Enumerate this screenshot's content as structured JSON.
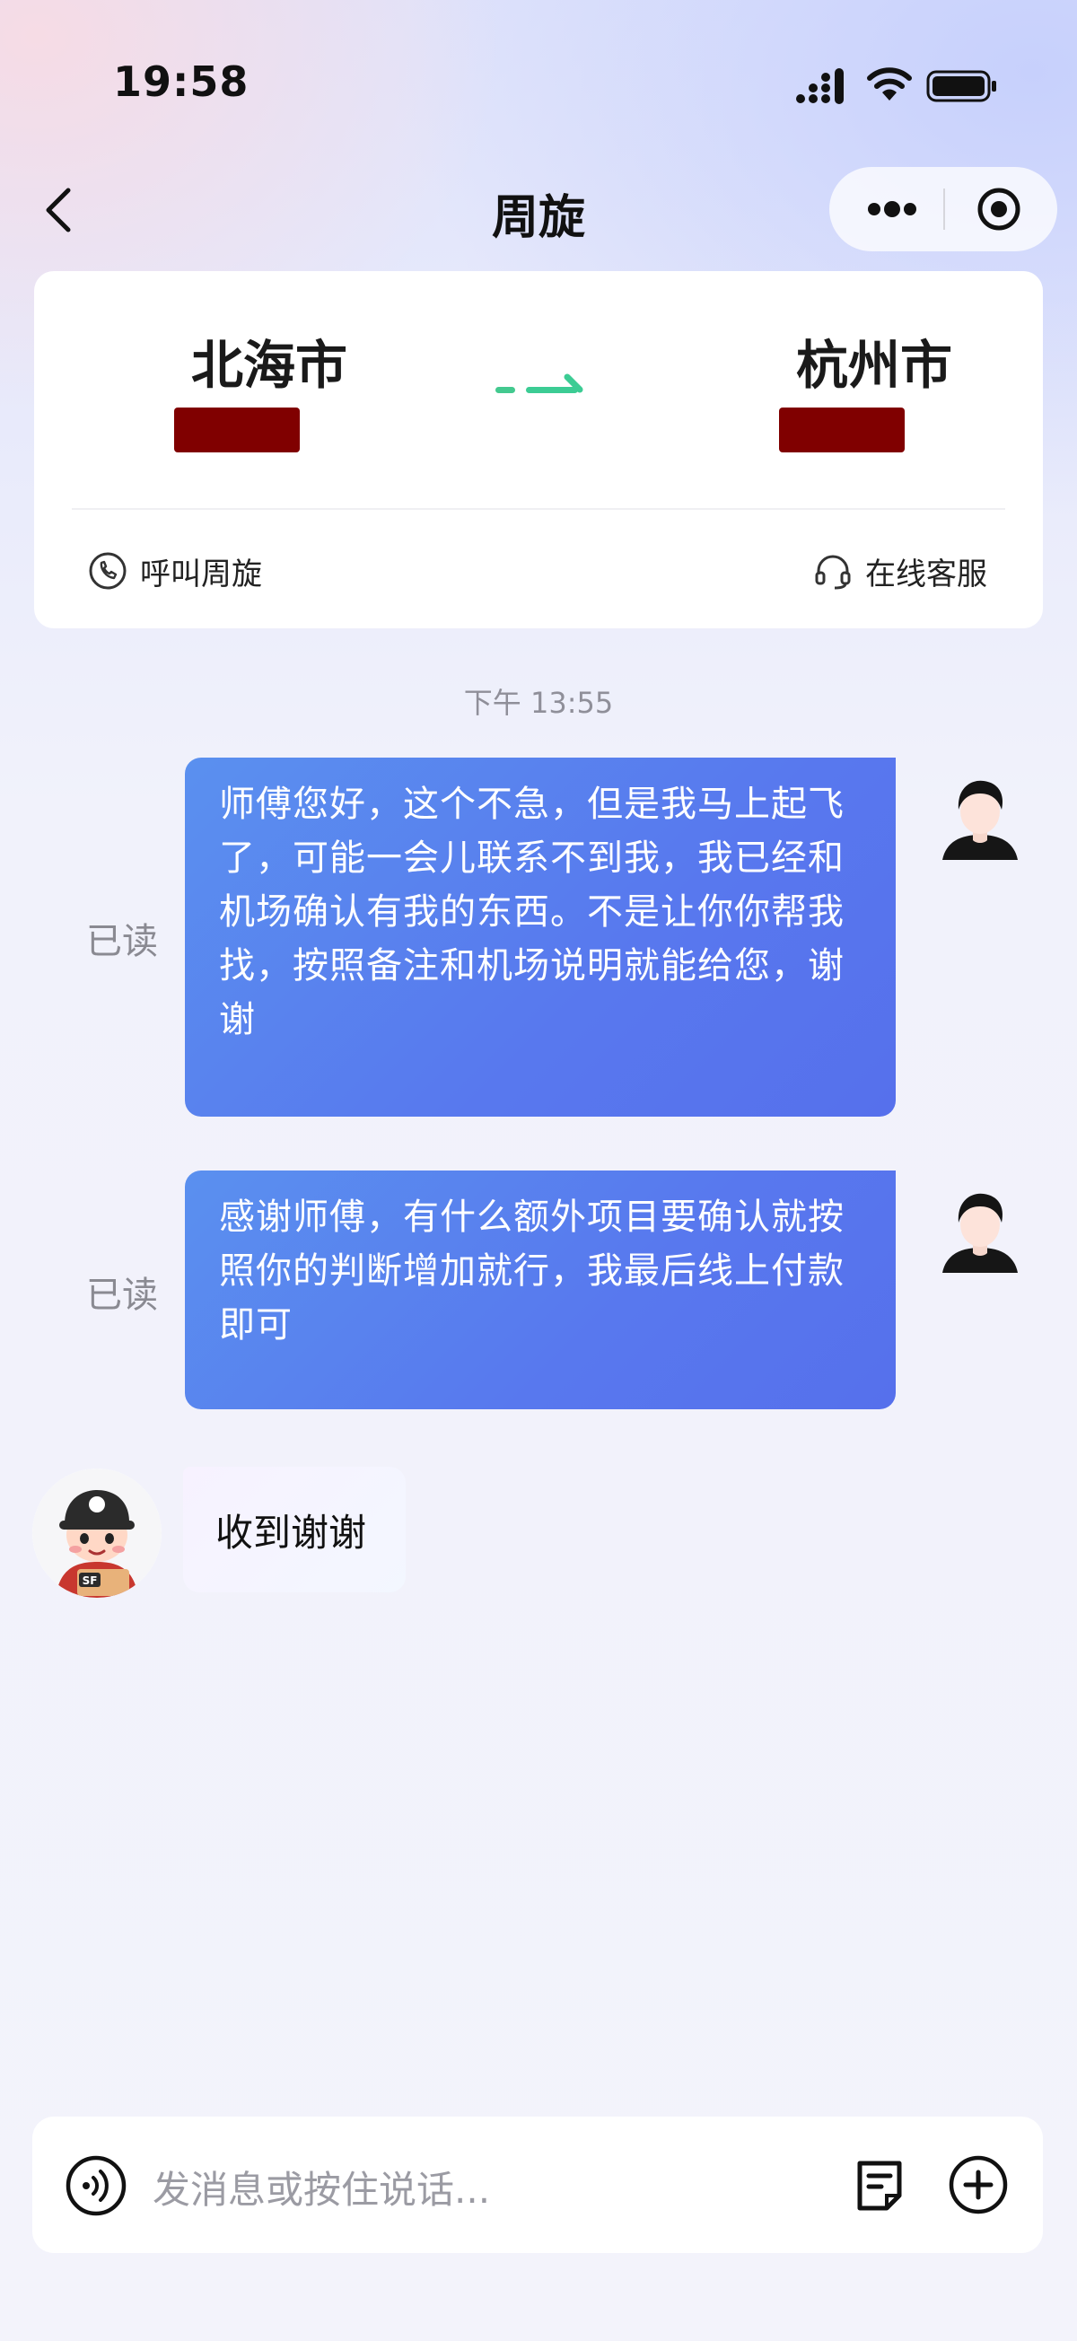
{
  "status_bar": {
    "time": "19:58"
  },
  "nav": {
    "title": "周旋"
  },
  "route": {
    "from_city": "北海市",
    "to_city": "杭州市",
    "call_label": "呼叫周旋",
    "service_label": "在线客服"
  },
  "chat": {
    "timestamp": "下午 13:55",
    "messages": [
      {
        "read_label": "已读",
        "text": "师傅您好，这个不急，但是我马上起飞了，可能一会儿联系不到我，我已经和机场确认有我的东西。不是让你你帮我找，按照备注和机场说明就能给您，谢谢"
      },
      {
        "read_label": "已读",
        "text": "感谢师傅，有什么额外项目要确认就按照你的判断增加就行，我最后线上付款即可"
      }
    ],
    "reply": {
      "text": "收到谢谢",
      "avatar_badge": "SF"
    }
  },
  "input": {
    "placeholder": "发消息或按住说话..."
  },
  "colors": {
    "bubble": "#5a82ee",
    "redaction": "#800000",
    "accent_green": "#3ccc94"
  }
}
